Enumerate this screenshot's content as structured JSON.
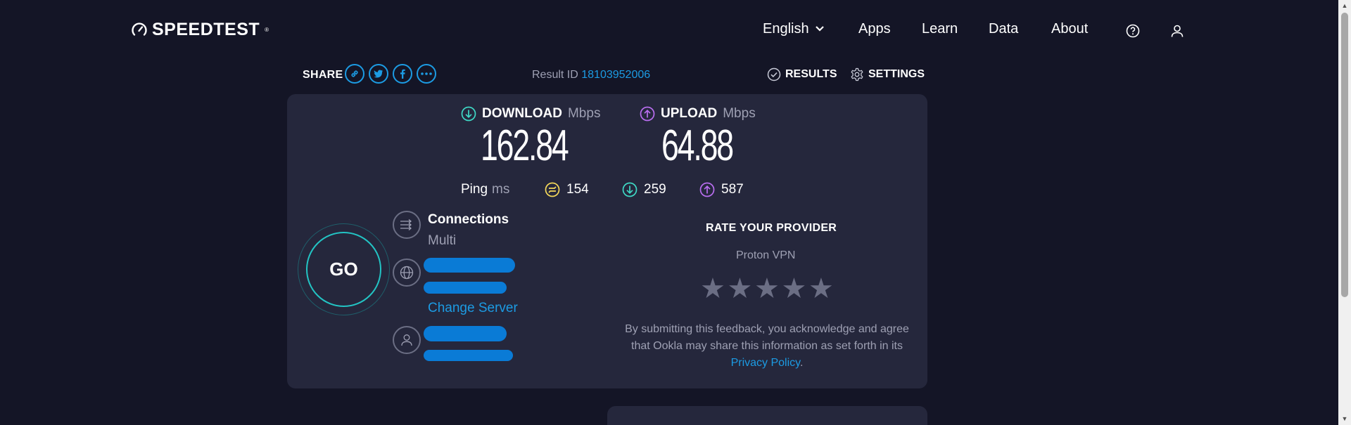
{
  "header": {
    "logo_text": "SPEEDTEST",
    "logo_tm": "®",
    "nav": {
      "language": "English",
      "apps": "Apps",
      "learn": "Learn",
      "data": "Data",
      "about": "About"
    }
  },
  "share": {
    "label": "SHARE",
    "icons": [
      "link-icon",
      "twitter-icon",
      "facebook-icon",
      "more-icon"
    ]
  },
  "result": {
    "label": "Result ID",
    "id": "18103952006"
  },
  "top_links": {
    "results": "RESULTS",
    "settings": "SETTINGS"
  },
  "download": {
    "label": "DOWNLOAD",
    "unit": "Mbps",
    "value": "162.84",
    "color": "#3fd9c6"
  },
  "upload": {
    "label": "UPLOAD",
    "unit": "Mbps",
    "value": "64.88",
    "color": "#b96ef0"
  },
  "ping": {
    "label": "Ping",
    "unit": "ms",
    "idle": "154",
    "download": "259",
    "upload": "587",
    "idle_color": "#f5d95a"
  },
  "go_button": "GO",
  "connections": {
    "title": "Connections",
    "mode": "Multi",
    "change_server": "Change Server"
  },
  "rating": {
    "title": "RATE YOUR PROVIDER",
    "provider": "Proton VPN",
    "stars_total": 5,
    "stars_selected": 0,
    "disclaimer_text": "By submitting this feedback, you acknowledge and agree that Ookla may share this information as set forth in its ",
    "privacy_link": "Privacy Policy",
    "period": "."
  },
  "colors": {
    "background": "#141526",
    "card": "#25273c",
    "accent_link": "#1c9be3",
    "redaction": "#0a7bd6"
  }
}
